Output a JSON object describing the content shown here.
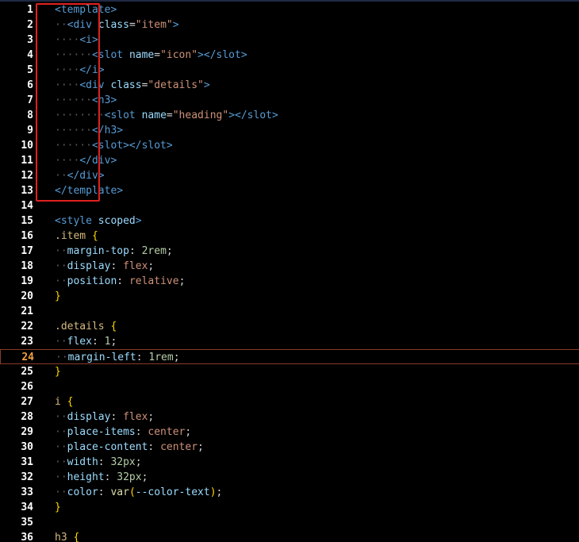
{
  "editor": {
    "lines": [
      {
        "n": "1",
        "tokens": [
          {
            "t": "<template>",
            "c": "tag"
          }
        ]
      },
      {
        "n": "2",
        "tokens": [
          {
            "t": "··",
            "c": "ws"
          },
          {
            "t": "<div ",
            "c": "tag"
          },
          {
            "t": "class",
            "c": "attr"
          },
          {
            "t": "=",
            "c": "pun"
          },
          {
            "t": "\"item\"",
            "c": "str"
          },
          {
            "t": ">",
            "c": "tag"
          }
        ]
      },
      {
        "n": "3",
        "tokens": [
          {
            "t": "····",
            "c": "ws"
          },
          {
            "t": "<i>",
            "c": "tag"
          }
        ]
      },
      {
        "n": "4",
        "tokens": [
          {
            "t": "······",
            "c": "ws"
          },
          {
            "t": "<slot ",
            "c": "tag"
          },
          {
            "t": "name",
            "c": "attr"
          },
          {
            "t": "=",
            "c": "pun"
          },
          {
            "t": "\"icon\"",
            "c": "str"
          },
          {
            "t": "></slot>",
            "c": "tag"
          }
        ]
      },
      {
        "n": "5",
        "tokens": [
          {
            "t": "····",
            "c": "ws"
          },
          {
            "t": "</i>",
            "c": "tag"
          }
        ]
      },
      {
        "n": "6",
        "tokens": [
          {
            "t": "····",
            "c": "ws"
          },
          {
            "t": "<div ",
            "c": "tag"
          },
          {
            "t": "class",
            "c": "attr"
          },
          {
            "t": "=",
            "c": "pun"
          },
          {
            "t": "\"details\"",
            "c": "str"
          },
          {
            "t": ">",
            "c": "tag"
          }
        ]
      },
      {
        "n": "7",
        "tokens": [
          {
            "t": "······",
            "c": "ws"
          },
          {
            "t": "<h3>",
            "c": "tag"
          }
        ]
      },
      {
        "n": "8",
        "tokens": [
          {
            "t": "········",
            "c": "ws"
          },
          {
            "t": "<slot ",
            "c": "tag"
          },
          {
            "t": "name",
            "c": "attr"
          },
          {
            "t": "=",
            "c": "pun"
          },
          {
            "t": "\"heading\"",
            "c": "str"
          },
          {
            "t": "></slot>",
            "c": "tag"
          }
        ]
      },
      {
        "n": "9",
        "tokens": [
          {
            "t": "······",
            "c": "ws"
          },
          {
            "t": "</h3>",
            "c": "tag"
          }
        ]
      },
      {
        "n": "10",
        "tokens": [
          {
            "t": "······",
            "c": "ws"
          },
          {
            "t": "<slot></slot>",
            "c": "tag"
          }
        ]
      },
      {
        "n": "11",
        "tokens": [
          {
            "t": "····",
            "c": "ws"
          },
          {
            "t": "</div>",
            "c": "tag"
          }
        ]
      },
      {
        "n": "12",
        "tokens": [
          {
            "t": "··",
            "c": "ws"
          },
          {
            "t": "</div>",
            "c": "tag"
          }
        ]
      },
      {
        "n": "13",
        "tokens": [
          {
            "t": "</template>",
            "c": "tag"
          }
        ]
      },
      {
        "n": "14",
        "tokens": []
      },
      {
        "n": "15",
        "tokens": [
          {
            "t": "<style ",
            "c": "tag"
          },
          {
            "t": "scoped",
            "c": "attr"
          },
          {
            "t": ">",
            "c": "tag"
          }
        ]
      },
      {
        "n": "16",
        "tokens": [
          {
            "t": ".item ",
            "c": "sel"
          },
          {
            "t": "{",
            "c": "brace"
          }
        ]
      },
      {
        "n": "17",
        "tokens": [
          {
            "t": "··",
            "c": "ws"
          },
          {
            "t": "margin-top",
            "c": "prop"
          },
          {
            "t": ": ",
            "c": "pun"
          },
          {
            "t": "2rem",
            "c": "num"
          },
          {
            "t": ";",
            "c": "pun"
          }
        ]
      },
      {
        "n": "18",
        "tokens": [
          {
            "t": "··",
            "c": "ws"
          },
          {
            "t": "display",
            "c": "prop"
          },
          {
            "t": ": ",
            "c": "pun"
          },
          {
            "t": "flex",
            "c": "kw"
          },
          {
            "t": ";",
            "c": "pun"
          }
        ]
      },
      {
        "n": "19",
        "tokens": [
          {
            "t": "··",
            "c": "ws"
          },
          {
            "t": "position",
            "c": "prop"
          },
          {
            "t": ": ",
            "c": "pun"
          },
          {
            "t": "relative",
            "c": "kw"
          },
          {
            "t": ";",
            "c": "pun"
          }
        ]
      },
      {
        "n": "20",
        "tokens": [
          {
            "t": "}",
            "c": "brace"
          }
        ]
      },
      {
        "n": "21",
        "tokens": []
      },
      {
        "n": "22",
        "tokens": [
          {
            "t": ".details ",
            "c": "sel"
          },
          {
            "t": "{",
            "c": "brace"
          }
        ]
      },
      {
        "n": "23",
        "tokens": [
          {
            "t": "··",
            "c": "ws"
          },
          {
            "t": "flex",
            "c": "prop"
          },
          {
            "t": ": ",
            "c": "pun"
          },
          {
            "t": "1",
            "c": "num"
          },
          {
            "t": ";",
            "c": "pun"
          }
        ]
      },
      {
        "n": "24",
        "current": true,
        "tokens": [
          {
            "t": "··",
            "c": "ws"
          },
          {
            "t": "margin-left",
            "c": "prop"
          },
          {
            "t": ": ",
            "c": "pun"
          },
          {
            "t": "1rem",
            "c": "num"
          },
          {
            "t": ";",
            "c": "pun"
          }
        ]
      },
      {
        "n": "25",
        "tokens": [
          {
            "t": "}",
            "c": "brace"
          }
        ]
      },
      {
        "n": "26",
        "tokens": []
      },
      {
        "n": "27",
        "tokens": [
          {
            "t": "i ",
            "c": "sel"
          },
          {
            "t": "{",
            "c": "brace"
          }
        ]
      },
      {
        "n": "28",
        "tokens": [
          {
            "t": "··",
            "c": "ws"
          },
          {
            "t": "display",
            "c": "prop"
          },
          {
            "t": ": ",
            "c": "pun"
          },
          {
            "t": "flex",
            "c": "kw"
          },
          {
            "t": ";",
            "c": "pun"
          }
        ]
      },
      {
        "n": "29",
        "tokens": [
          {
            "t": "··",
            "c": "ws"
          },
          {
            "t": "place-items",
            "c": "prop"
          },
          {
            "t": ": ",
            "c": "pun"
          },
          {
            "t": "center",
            "c": "kw"
          },
          {
            "t": ";",
            "c": "pun"
          }
        ]
      },
      {
        "n": "30",
        "tokens": [
          {
            "t": "··",
            "c": "ws"
          },
          {
            "t": "place-content",
            "c": "prop"
          },
          {
            "t": ": ",
            "c": "pun"
          },
          {
            "t": "center",
            "c": "kw"
          },
          {
            "t": ";",
            "c": "pun"
          }
        ]
      },
      {
        "n": "31",
        "tokens": [
          {
            "t": "··",
            "c": "ws"
          },
          {
            "t": "width",
            "c": "prop"
          },
          {
            "t": ": ",
            "c": "pun"
          },
          {
            "t": "32px",
            "c": "num"
          },
          {
            "t": ";",
            "c": "pun"
          }
        ]
      },
      {
        "n": "32",
        "tokens": [
          {
            "t": "··",
            "c": "ws"
          },
          {
            "t": "height",
            "c": "prop"
          },
          {
            "t": ": ",
            "c": "pun"
          },
          {
            "t": "32px",
            "c": "num"
          },
          {
            "t": ";",
            "c": "pun"
          }
        ]
      },
      {
        "n": "33",
        "tokens": [
          {
            "t": "··",
            "c": "ws"
          },
          {
            "t": "color",
            "c": "prop"
          },
          {
            "t": ": ",
            "c": "pun"
          },
          {
            "t": "var",
            "c": "fn"
          },
          {
            "t": "(",
            "c": "brace"
          },
          {
            "t": "--color-text",
            "c": "prop"
          },
          {
            "t": ")",
            "c": "brace"
          },
          {
            "t": ";",
            "c": "pun"
          }
        ]
      },
      {
        "n": "34",
        "tokens": [
          {
            "t": "}",
            "c": "brace"
          }
        ]
      },
      {
        "n": "35",
        "tokens": []
      },
      {
        "n": "36",
        "tokens": [
          {
            "t": "h3 ",
            "c": "sel"
          },
          {
            "t": "{",
            "c": "brace"
          }
        ]
      }
    ]
  },
  "colors": {
    "background": "#000000",
    "annotation_box": "#e02020",
    "current_line_border": "#8a3a28",
    "current_line_number": "#f0a040"
  }
}
